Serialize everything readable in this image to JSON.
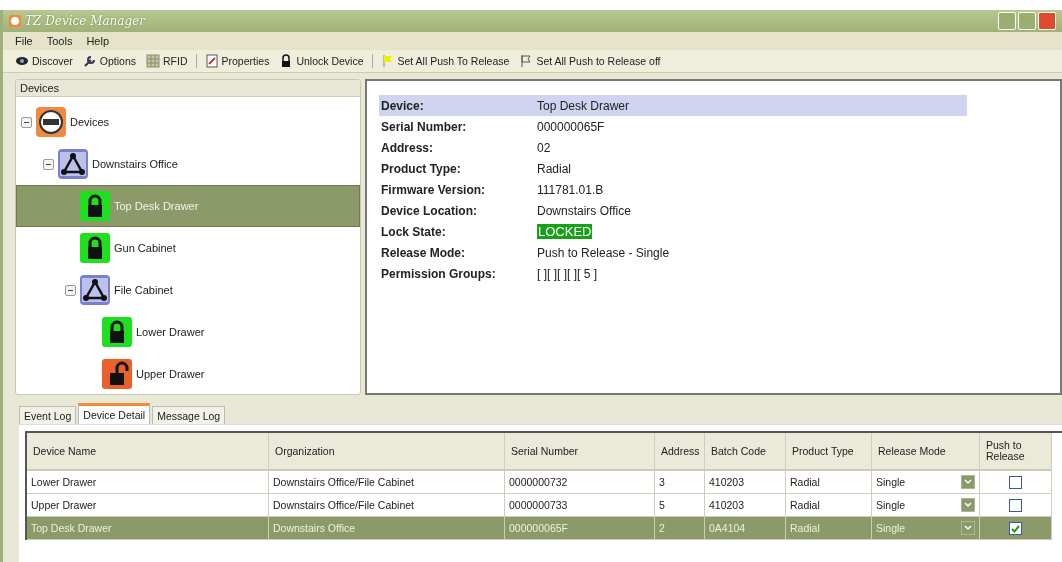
{
  "window": {
    "title": "TZ Device Manager"
  },
  "menu": [
    "File",
    "Tools",
    "Help"
  ],
  "toolbar": [
    {
      "kind": "eye",
      "label": "Discover"
    },
    {
      "kind": "wrench",
      "label": "Options"
    },
    {
      "kind": "grid",
      "label": "RFID"
    },
    {
      "kind": "sep"
    },
    {
      "kind": "doc",
      "label": "Properties"
    },
    {
      "kind": "padlock",
      "label": "Unlock Device"
    },
    {
      "kind": "sep"
    },
    {
      "kind": "flag",
      "label": "Set All Push To Release"
    },
    {
      "kind": "flag-off",
      "label": "Set All Push to Release off"
    }
  ],
  "devices_panel": {
    "title": "Devices",
    "tree": [
      {
        "kind": "root",
        "label": "Devices",
        "expanded": true,
        "selected": false,
        "children": [
          {
            "kind": "group",
            "label": "Downstairs Office",
            "expanded": true,
            "selected": false,
            "children": [
              {
                "kind": "lock",
                "label": "Top Desk Drawer",
                "locked": true,
                "selected": true
              },
              {
                "kind": "lock",
                "label": "Gun Cabinet",
                "locked": true,
                "selected": false
              },
              {
                "kind": "group",
                "label": "File Cabinet",
                "expanded": true,
                "selected": false,
                "children": [
                  {
                    "kind": "lock",
                    "label": "Lower Drawer",
                    "locked": true,
                    "selected": false
                  },
                  {
                    "kind": "lock",
                    "label": "Upper Drawer",
                    "locked": false,
                    "selected": false
                  }
                ]
              }
            ]
          }
        ]
      }
    ]
  },
  "details": [
    {
      "label": "Device:",
      "value": "Top Desk Drawer",
      "kind": "header"
    },
    {
      "label": "Serial Number:",
      "value": "000000065F",
      "kind": "plain"
    },
    {
      "label": "Address:",
      "value": "02",
      "kind": "plain"
    },
    {
      "label": "Product Type:",
      "value": "Radial",
      "kind": "plain"
    },
    {
      "label": "Firmware Version:",
      "value": "111781.01.B",
      "kind": "plain"
    },
    {
      "label": "Device Location:",
      "value": "Downstairs Office",
      "kind": "plain"
    },
    {
      "label": "Lock State:",
      "value": "LOCKED",
      "kind": "status"
    },
    {
      "label": "Release Mode:",
      "value": "Push to Release - Single",
      "kind": "plain"
    },
    {
      "label": "Permission Groups:",
      "value": "[ ][ ][ ][ ][ 5 ]",
      "kind": "plain"
    }
  ],
  "tabs": [
    {
      "label": "Event Log",
      "selected": false
    },
    {
      "label": "Device Detail",
      "selected": true
    },
    {
      "label": "Message Log",
      "selected": false
    }
  ],
  "table": {
    "columns": [
      "Device Name",
      "Organization",
      "Serial Number",
      "Address",
      "Batch Code",
      "Product Type",
      "Release Mode",
      "Push to Release"
    ],
    "rows": [
      {
        "cells": [
          "Lower Drawer",
          "Downstairs Office/File Cabinet",
          "0000000732",
          "3",
          "410203",
          "Radial",
          "Single"
        ],
        "push": false,
        "selected": false
      },
      {
        "cells": [
          "Upper Drawer",
          "Downstairs Office/File Cabinet",
          "0000000733",
          "5",
          "410203",
          "Radial",
          "Single"
        ],
        "push": false,
        "selected": false
      },
      {
        "cells": [
          "Top Desk Drawer",
          "Downstairs Office",
          "000000065F",
          "2",
          "0A4104",
          "Radial",
          "Single"
        ],
        "push": true,
        "selected": true
      }
    ]
  }
}
